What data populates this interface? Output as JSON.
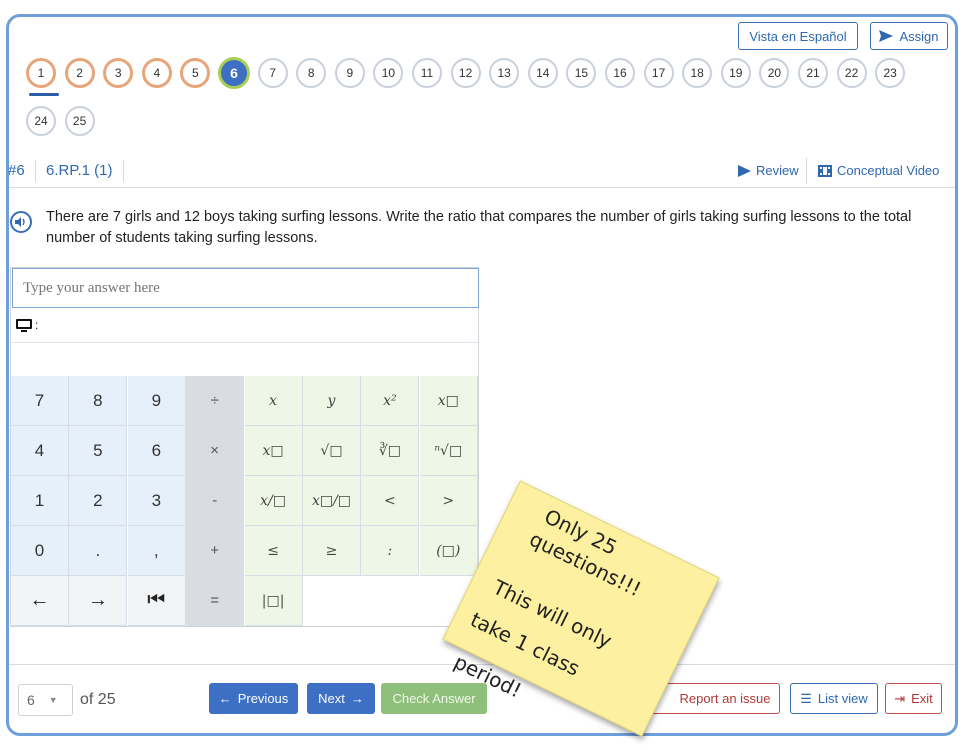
{
  "top_buttons": {
    "spanish": "Vista en Español",
    "assign": "Assign"
  },
  "question_numbers": [
    "1",
    "2",
    "3",
    "4",
    "5",
    "6",
    "7",
    "8",
    "9",
    "10",
    "11",
    "12",
    "13",
    "14",
    "15",
    "16",
    "17",
    "18",
    "19",
    "20",
    "21",
    "22",
    "23",
    "24",
    "25"
  ],
  "question_header": {
    "number": "#6",
    "standard": "6.RP.1 (1)",
    "review": "Review",
    "video": "Conceptual Video"
  },
  "question_text": "There are 7 girls and 12 boys taking surfing lessons. Write the ratio that compares the number of girls taking surfing lessons to the total number of students taking surfing lessons.",
  "answer": {
    "placeholder": "Type your answer here",
    "preview_label": ":"
  },
  "keypad": {
    "rows": [
      [
        "7",
        "8",
        "9",
        "÷",
        "x",
        "y",
        "x²",
        "x□"
      ],
      [
        "4",
        "5",
        "6",
        "×",
        "x□",
        "√□",
        "∛□",
        "ⁿ√□"
      ],
      [
        "1",
        "2",
        "3",
        "-",
        "x/□",
        "x□/□",
        "<",
        ">"
      ],
      [
        "0",
        ".",
        ",",
        "+",
        "≤",
        "≥",
        ":",
        "(□)"
      ],
      [
        "←",
        "→",
        "⏮",
        "=",
        "|□|"
      ]
    ]
  },
  "footer": {
    "page_select": "6",
    "of_total": "of 25",
    "previous": "Previous",
    "next": "Next",
    "check": "Check Answer",
    "report": "Report an issue",
    "list_view": "List view",
    "exit": "Exit"
  },
  "sticky_note": {
    "line1": "Only 25",
    "line2": "questions!!!",
    "line3": "This will only",
    "line4": "take 1 class",
    "line5": "period!"
  },
  "colors": {
    "accent": "#3d6fc4",
    "done_ring": "#e7a57a",
    "current_ring": "#a9cf54",
    "check": "#8ec07c",
    "sticky": "#fdf0a0"
  }
}
